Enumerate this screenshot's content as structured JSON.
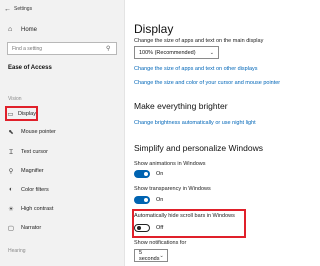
{
  "window": {
    "title": "Settings"
  },
  "sidebar": {
    "home_label": "Home",
    "search_placeholder": "Find a setting",
    "section_title": "Ease of Access",
    "group_vision": "Vision",
    "items": [
      {
        "label": "Display",
        "icon": "display-icon",
        "active": true
      },
      {
        "label": "Mouse pointer",
        "icon": "mouse-pointer-icon"
      },
      {
        "label": "Text cursor",
        "icon": "text-cursor-icon"
      },
      {
        "label": "Magnifier",
        "icon": "magnifier-icon"
      },
      {
        "label": "Color filters",
        "icon": "color-filters-icon"
      },
      {
        "label": "High contrast",
        "icon": "high-contrast-icon"
      },
      {
        "label": "Narrator",
        "icon": "narrator-icon"
      }
    ],
    "group_hearing": "Hearing"
  },
  "main": {
    "title": "Display",
    "size_desc": "Change the size of apps and text on the main display",
    "size_value": "100% (Recommended)",
    "link_other_displays": "Change the size of apps and text on other displays",
    "link_text_color": "Change the size and color of your cursor and mouse pointer",
    "brighter_heading": "Make everything brighter",
    "link_brightness": "Change brightness automatically or use night light",
    "simplify_heading": "Simplify and personalize Windows",
    "animations_label": "Show animations in Windows",
    "animations_state": "On",
    "transparency_label": "Show transparency in Windows",
    "transparency_state": "On",
    "scrollbars_label": "Automatically hide scroll bars in Windows",
    "scrollbars_state": "Off",
    "notifications_label": "Show notifications for",
    "notifications_value": "5 seconds"
  },
  "colors": {
    "accent": "#0063b1",
    "link": "#0066b8",
    "highlight": "#e0202a"
  }
}
